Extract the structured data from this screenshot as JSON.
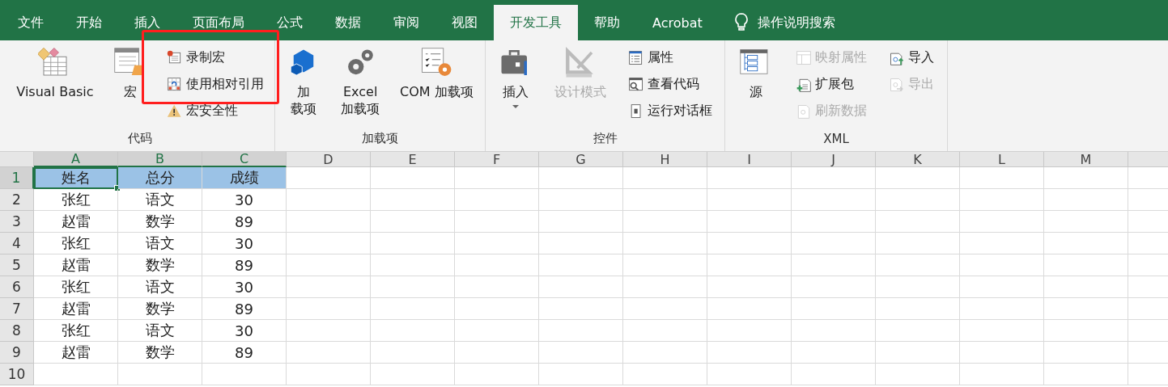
{
  "tabs": [
    {
      "label": "文件",
      "selected": false
    },
    {
      "label": "开始",
      "selected": false
    },
    {
      "label": "插入",
      "selected": false
    },
    {
      "label": "页面布局",
      "selected": false
    },
    {
      "label": "公式",
      "selected": false
    },
    {
      "label": "数据",
      "selected": false
    },
    {
      "label": "审阅",
      "selected": false
    },
    {
      "label": "视图",
      "selected": false
    },
    {
      "label": "开发工具",
      "selected": true
    },
    {
      "label": "帮助",
      "selected": false
    },
    {
      "label": "Acrobat",
      "selected": false
    }
  ],
  "search": {
    "label": "操作说明搜索"
  },
  "ribbon": {
    "groups": [
      {
        "label": "代码",
        "controls": [
          {
            "kind": "large",
            "label": "Visual Basic",
            "disabled": false,
            "dropdown": false
          },
          {
            "kind": "large",
            "label": "宏",
            "disabled": false,
            "dropdown": false
          },
          {
            "kind": "stack",
            "items": [
              {
                "label": "录制宏",
                "disabled": false
              },
              {
                "label": "使用相对引用",
                "disabled": false
              },
              {
                "label": "宏安全性",
                "disabled": false
              }
            ]
          }
        ]
      },
      {
        "label": "加载项",
        "controls": [
          {
            "kind": "large",
            "lines": [
              "加",
              "载项"
            ],
            "disabled": false,
            "dropdown": false
          },
          {
            "kind": "large",
            "lines": [
              "Excel",
              "加载项"
            ],
            "disabled": false,
            "dropdown": false
          },
          {
            "kind": "large",
            "label": "COM 加载项",
            "disabled": false,
            "dropdown": false
          }
        ]
      },
      {
        "label": "控件",
        "controls": [
          {
            "kind": "large",
            "label": "插入",
            "disabled": false,
            "dropdown": true
          },
          {
            "kind": "large",
            "label": "设计模式",
            "disabled": true,
            "dropdown": false
          },
          {
            "kind": "stack",
            "items": [
              {
                "label": "属性",
                "disabled": false
              },
              {
                "label": "查看代码",
                "disabled": false
              },
              {
                "label": "运行对话框",
                "disabled": false
              }
            ]
          }
        ]
      },
      {
        "label": "XML",
        "controls": [
          {
            "kind": "large",
            "label": "源",
            "disabled": false,
            "dropdown": false
          },
          {
            "kind": "stack",
            "items": [
              {
                "label": "映射属性",
                "disabled": true
              },
              {
                "label": "扩展包",
                "disabled": false
              },
              {
                "label": "刷新数据",
                "disabled": true
              }
            ]
          },
          {
            "kind": "stack",
            "items": [
              {
                "label": "导入",
                "disabled": false
              },
              {
                "label": "导出",
                "disabled": true
              }
            ]
          }
        ]
      }
    ]
  },
  "sheet": {
    "columns": [
      {
        "label": "A",
        "selected": true
      },
      {
        "label": "B",
        "selected": true
      },
      {
        "label": "C",
        "selected": true
      },
      {
        "label": "D",
        "selected": false
      },
      {
        "label": "E",
        "selected": false
      },
      {
        "label": "F",
        "selected": false
      },
      {
        "label": "G",
        "selected": false
      },
      {
        "label": "H",
        "selected": false
      },
      {
        "label": "I",
        "selected": false
      },
      {
        "label": "J",
        "selected": false
      },
      {
        "label": "K",
        "selected": false
      },
      {
        "label": "L",
        "selected": false
      },
      {
        "label": "M",
        "selected": false
      }
    ],
    "rows": [
      {
        "number": "1",
        "selected": true,
        "cells": [
          {
            "text": "姓名",
            "selected": true,
            "active": true
          },
          {
            "text": "总分",
            "selected": true,
            "active": false
          },
          {
            "text": "成绩",
            "selected": true,
            "active": false
          }
        ]
      },
      {
        "number": "2",
        "selected": false,
        "cells": [
          {
            "text": "张红",
            "selected": false,
            "active": false
          },
          {
            "text": "语文",
            "selected": false,
            "active": false
          },
          {
            "text": "30",
            "selected": false,
            "active": false
          }
        ]
      },
      {
        "number": "3",
        "selected": false,
        "cells": [
          {
            "text": "赵雷",
            "selected": false,
            "active": false
          },
          {
            "text": "数学",
            "selected": false,
            "active": false
          },
          {
            "text": "89",
            "selected": false,
            "active": false
          }
        ]
      },
      {
        "number": "4",
        "selected": false,
        "cells": [
          {
            "text": "张红",
            "selected": false,
            "active": false
          },
          {
            "text": "语文",
            "selected": false,
            "active": false
          },
          {
            "text": "30",
            "selected": false,
            "active": false
          }
        ]
      },
      {
        "number": "5",
        "selected": false,
        "cells": [
          {
            "text": "赵雷",
            "selected": false,
            "active": false
          },
          {
            "text": "数学",
            "selected": false,
            "active": false
          },
          {
            "text": "89",
            "selected": false,
            "active": false
          }
        ]
      },
      {
        "number": "6",
        "selected": false,
        "cells": [
          {
            "text": "张红",
            "selected": false,
            "active": false
          },
          {
            "text": "语文",
            "selected": false,
            "active": false
          },
          {
            "text": "30",
            "selected": false,
            "active": false
          }
        ]
      },
      {
        "number": "7",
        "selected": false,
        "cells": [
          {
            "text": "赵雷",
            "selected": false,
            "active": false
          },
          {
            "text": "数学",
            "selected": false,
            "active": false
          },
          {
            "text": "89",
            "selected": false,
            "active": false
          }
        ]
      },
      {
        "number": "8",
        "selected": false,
        "cells": [
          {
            "text": "张红",
            "selected": false,
            "active": false
          },
          {
            "text": "语文",
            "selected": false,
            "active": false
          },
          {
            "text": "30",
            "selected": false,
            "active": false
          }
        ]
      },
      {
        "number": "9",
        "selected": false,
        "cells": [
          {
            "text": "赵雷",
            "selected": false,
            "active": false
          },
          {
            "text": "数学",
            "selected": false,
            "active": false
          },
          {
            "text": "89",
            "selected": false,
            "active": false
          }
        ]
      },
      {
        "number": "10",
        "selected": false,
        "cells": []
      }
    ]
  }
}
